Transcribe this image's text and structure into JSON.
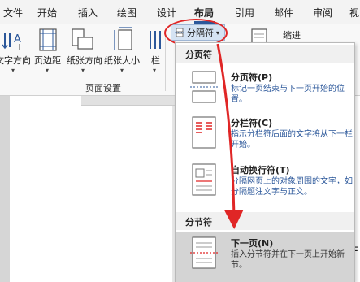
{
  "tabs": [
    {
      "label": "文件"
    },
    {
      "label": "开始"
    },
    {
      "label": "插入"
    },
    {
      "label": "绘图"
    },
    {
      "label": "设计"
    },
    {
      "label": "布局"
    },
    {
      "label": "引用"
    },
    {
      "label": "邮件"
    },
    {
      "label": "审阅"
    },
    {
      "label": "视"
    }
  ],
  "ribbon": {
    "text_direction": "文字方向",
    "margins": "页边距",
    "orientation": "纸张方向",
    "size": "纸张大小",
    "columns": "栏",
    "group_label": "页面设置",
    "breaks_label": "分隔符",
    "indent_label": "缩进"
  },
  "menu": {
    "page_breaks_header": "分页符",
    "section_breaks_header": "分节符",
    "items": [
      {
        "title": "分页符(P)",
        "desc": "标记一页结束与下一页开始的位置。"
      },
      {
        "title": "分栏符(C)",
        "desc": "指示分栏符后面的文字将从下一栏开始。"
      },
      {
        "title": "自动换行符(T)",
        "desc": "分隔网页上的对象周围的文字，如分隔题注文字与正文。"
      },
      {
        "title": "下一页(N)",
        "desc": "插入分节符并在下一页上开始新节。"
      }
    ]
  },
  "colors": {
    "accent": "#2b579a",
    "annotation": "#e02626"
  },
  "cut_char": "F"
}
